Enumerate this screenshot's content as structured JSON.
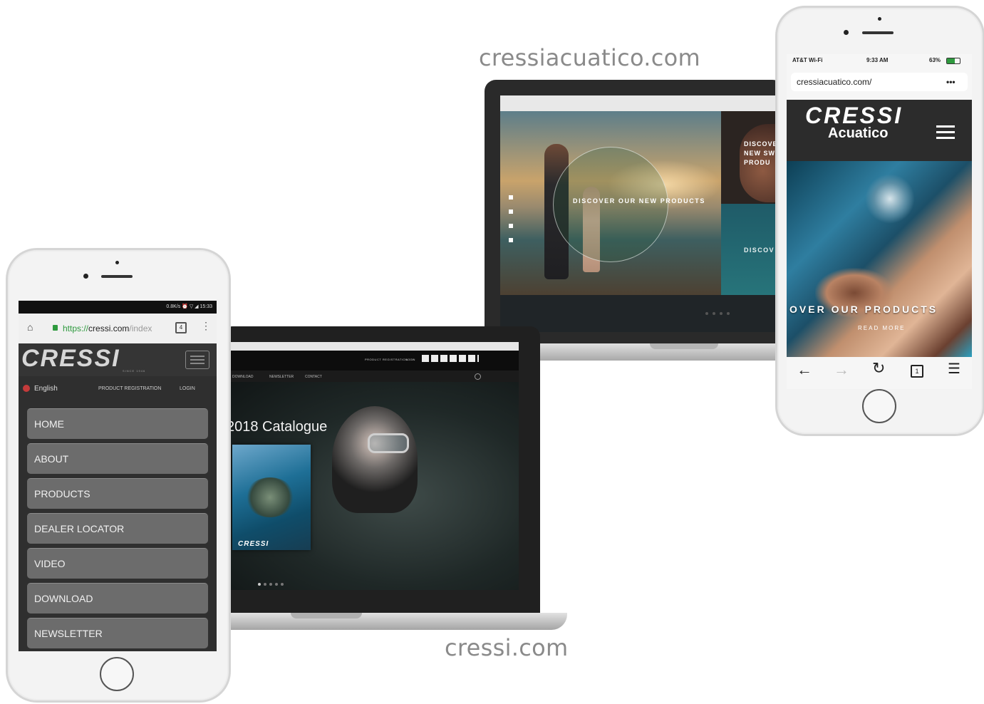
{
  "captions": {
    "acuatico_domain": "cressiacuatico.com",
    "cressi_domain": "cressi.com"
  },
  "phone_left": {
    "status_bar": "0.8K/s ⏰ ▽ ◢ 15:33",
    "url_prefix": "https://",
    "url_host": "cressi.com",
    "url_suffix": "/index",
    "tab_count": "4",
    "logo": "CRESSI",
    "logo_tagline": "SINCE 1946",
    "language": "English",
    "nav_product_registration": "PRODUCT REGISTRATION",
    "nav_login": "LOGIN",
    "menu": [
      "HOME",
      "ABOUT",
      "PRODUCTS",
      "DEALER LOCATOR",
      "VIDEO",
      "DOWNLOAD",
      "NEWSLETTER"
    ]
  },
  "laptop_front": {
    "nav": [
      "DOWNLOAD",
      "NEWSLETTER",
      "CONTACT"
    ],
    "top_links": [
      "PRODUCT REGISTRATION",
      "LOGIN"
    ],
    "hero_title": "2018 Catalogue",
    "catalogue_logo": "CRESSI"
  },
  "laptop_back": {
    "hero_text": "DISCOVER OUR NEW PRODUCTS",
    "side_text": "DISCOVER NEW SW PRODU",
    "side_text_2": "DISCOV"
  },
  "phone_right": {
    "carrier": "AT&T Wi-Fi",
    "time": "9:33 AM",
    "battery": "63%",
    "url": "cressiacuatico.com/",
    "url_menu": "•••",
    "logo_line1": "CRESSI",
    "logo_line2": "Acuatico",
    "hero_text": "OVER OUR PRODUCTS",
    "read_more": "READ MORE",
    "tab_count": "1"
  },
  "colors": {
    "accent_green": "#2e9a3e",
    "caption_gray": "#8a8a8a",
    "menu_button": "#6c6c6c"
  }
}
